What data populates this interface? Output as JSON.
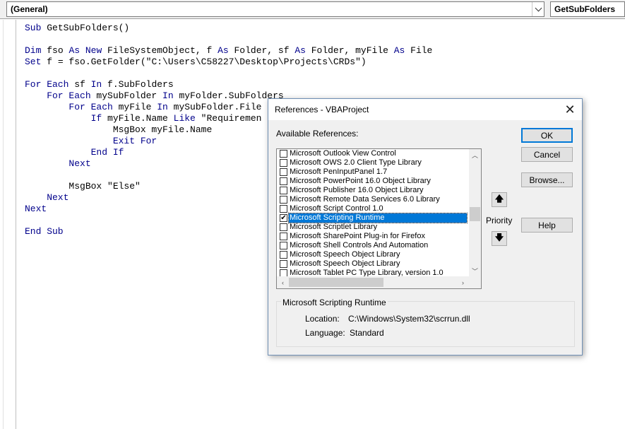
{
  "combos": {
    "object": "(General)",
    "procedure": "GetSubFolders"
  },
  "code_lines": [
    [
      {
        "t": "Sub ",
        "k": 1
      },
      {
        "t": "GetSubFolders()",
        "k": 0
      }
    ],
    [],
    [
      {
        "t": "Dim ",
        "k": 1
      },
      {
        "t": "fso ",
        "k": 0
      },
      {
        "t": "As New ",
        "k": 1
      },
      {
        "t": "FileSystemObject, f ",
        "k": 0
      },
      {
        "t": "As ",
        "k": 1
      },
      {
        "t": "Folder, sf ",
        "k": 0
      },
      {
        "t": "As ",
        "k": 1
      },
      {
        "t": "Folder, myFile ",
        "k": 0
      },
      {
        "t": "As ",
        "k": 1
      },
      {
        "t": "File",
        "k": 0
      }
    ],
    [
      {
        "t": "Set ",
        "k": 1
      },
      {
        "t": "f = fso.GetFolder(\"C:\\Users\\C58227\\Desktop\\Projects\\CRDs\")",
        "k": 0
      }
    ],
    [],
    [
      {
        "t": "For Each ",
        "k": 1
      },
      {
        "t": "sf ",
        "k": 0
      },
      {
        "t": "In ",
        "k": 1
      },
      {
        "t": "f.SubFolders",
        "k": 0
      }
    ],
    [
      {
        "t": "    For Each ",
        "k": 1
      },
      {
        "t": "mySubFolder ",
        "k": 0
      },
      {
        "t": "In ",
        "k": 1
      },
      {
        "t": "myFolder.SubFolders",
        "k": 0
      }
    ],
    [
      {
        "t": "        For Each ",
        "k": 1
      },
      {
        "t": "myFile ",
        "k": 0
      },
      {
        "t": "In ",
        "k": 1
      },
      {
        "t": "mySubFolder.File",
        "k": 0
      }
    ],
    [
      {
        "t": "            If ",
        "k": 1
      },
      {
        "t": "myFile.Name ",
        "k": 0
      },
      {
        "t": "Like ",
        "k": 1
      },
      {
        "t": "\"Requiremen",
        "k": 0
      }
    ],
    [
      {
        "t": "                MsgBox myFile.Name",
        "k": 0
      }
    ],
    [
      {
        "t": "                Exit For",
        "k": 1
      }
    ],
    [
      {
        "t": "            End If",
        "k": 1
      }
    ],
    [
      {
        "t": "        Next",
        "k": 1
      }
    ],
    [],
    [
      {
        "t": "        MsgBox \"Else\"",
        "k": 0
      }
    ],
    [
      {
        "t": "    Next",
        "k": 1
      }
    ],
    [
      {
        "t": "Next",
        "k": 1
      }
    ],
    [],
    [
      {
        "t": "End Sub",
        "k": 1
      }
    ]
  ],
  "dialog": {
    "title": "References - VBAProject",
    "available_label": "Available References:",
    "references": [
      {
        "label": "Microsoft Outlook View Control",
        "checked": false
      },
      {
        "label": "Microsoft OWS 2.0 Client Type Library",
        "checked": false
      },
      {
        "label": "Microsoft PenInputPanel 1.7",
        "checked": false
      },
      {
        "label": "Microsoft PowerPoint 16.0 Object Library",
        "checked": false
      },
      {
        "label": "Microsoft Publisher 16.0 Object Library",
        "checked": false
      },
      {
        "label": "Microsoft Remote Data Services 6.0 Library",
        "checked": false
      },
      {
        "label": "Microsoft Script Control 1.0",
        "checked": false
      },
      {
        "label": "Microsoft Scripting Runtime",
        "checked": true,
        "selected": true
      },
      {
        "label": "Microsoft Scriptlet Library",
        "checked": false
      },
      {
        "label": "Microsoft SharePoint Plug-in for Firefox",
        "checked": false
      },
      {
        "label": "Microsoft Shell Controls And Automation",
        "checked": false
      },
      {
        "label": "Microsoft Speech Object Library",
        "checked": false
      },
      {
        "label": "Microsoft Speech Object Library",
        "checked": false
      },
      {
        "label": "Microsoft Tablet PC Type Library, version 1.0",
        "checked": false
      }
    ],
    "buttons": {
      "ok": "OK",
      "cancel": "Cancel",
      "browse": "Browse...",
      "help": "Help"
    },
    "priority_label": "Priority",
    "priority_up": "🡅",
    "priority_down": "🡇",
    "selected_name": "Microsoft Scripting Runtime",
    "location_label": "Location:",
    "location_value": "C:\\Windows\\System32\\scrrun.dll",
    "language_label": "Language:",
    "language_value": "Standard"
  }
}
